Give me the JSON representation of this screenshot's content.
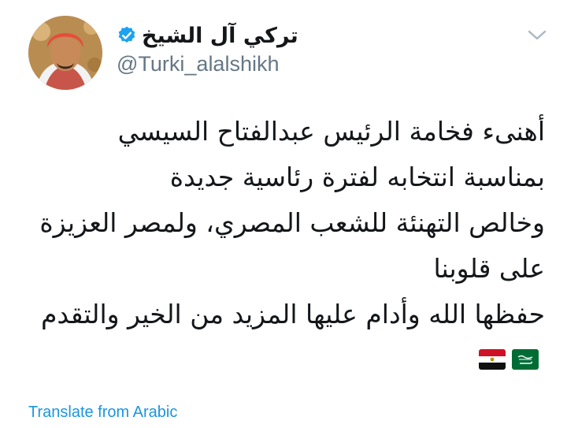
{
  "user": {
    "display_name": "تركي آل الشيخ",
    "handle": "@Turki_alalshikh",
    "verified": true
  },
  "tweet": {
    "lines": [
      "أهنىء فخامة الرئيس عبدالفتاح السيسي",
      "بمناسبة انتخابه لفترة رئاسية جديدة",
      "وخالص التهنئة للشعب المصري، ولمصر العزيزة",
      "على قلوبنا",
      "حفظها الله وأدام عليها المزيد من الخير والتقدم"
    ],
    "flags": [
      "saudi-flag-icon",
      "egypt-flag-icon"
    ]
  },
  "translate_label": "Translate from Arabic",
  "colors": {
    "verified_blue": "#1da1f2",
    "link_blue": "#1b95e0",
    "handle_gray": "#657786",
    "text": "#14171a"
  }
}
